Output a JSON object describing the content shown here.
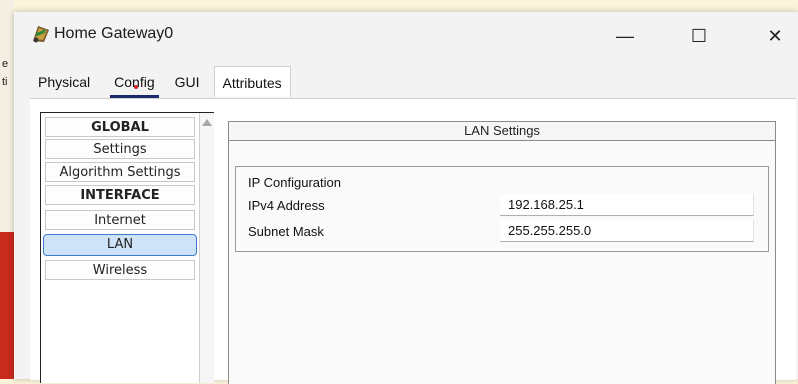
{
  "background": {
    "side_texts": [
      "e",
      "ti"
    ]
  },
  "window": {
    "title": "Home Gateway0",
    "icon": "router-icon",
    "controls": {
      "minimize": "—",
      "maximize": "☐",
      "close": "✕"
    }
  },
  "tabs": [
    {
      "label": "Physical"
    },
    {
      "label": "Config"
    },
    {
      "label": "GUI"
    },
    {
      "label": "Attributes"
    }
  ],
  "sidebar": {
    "items": [
      {
        "label": "GLOBAL"
      },
      {
        "label": "Settings"
      },
      {
        "label": "Algorithm Settings"
      },
      {
        "label": "INTERFACE"
      },
      {
        "label": "Internet"
      },
      {
        "label": "LAN"
      },
      {
        "label": "Wireless"
      }
    ]
  },
  "lan": {
    "header": "LAN Settings",
    "group_title": "IP Configuration",
    "ipv4_label": "IPv4 Address",
    "ipv4_value": "192.168.25.1",
    "mask_label": "Subnet Mask",
    "mask_value": "255.255.255.0"
  },
  "colors": {
    "selected_item": "#cfe3f8",
    "tab_underline": "#1a2a6c"
  }
}
